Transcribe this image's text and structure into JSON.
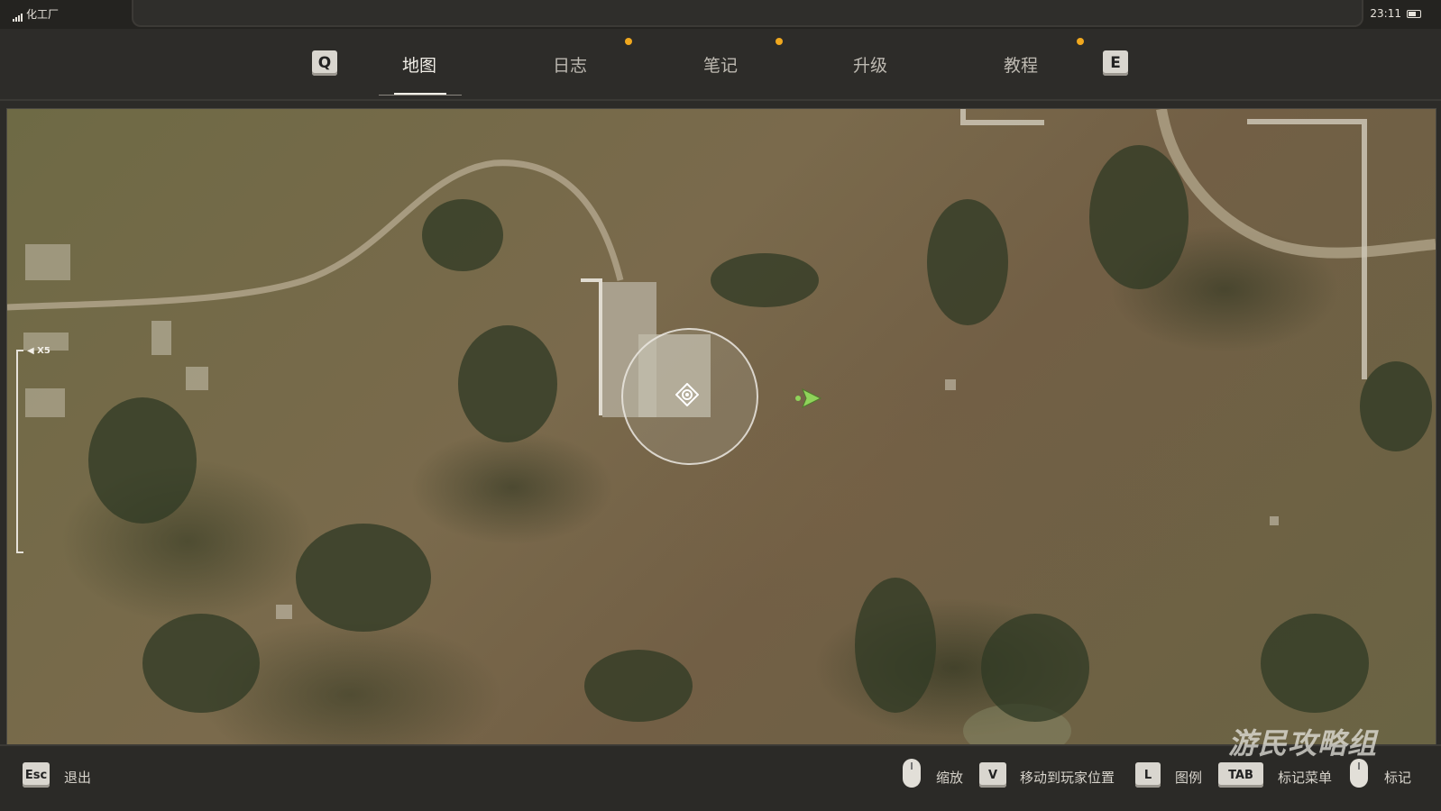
{
  "status": {
    "signal_label": "化工厂",
    "time": "23:11"
  },
  "tabs": {
    "left_key": "Q",
    "right_key": "E",
    "items": [
      {
        "label": "地图",
        "active": true,
        "notification": false
      },
      {
        "label": "日志",
        "active": false,
        "notification": true
      },
      {
        "label": "笔记",
        "active": false,
        "notification": true
      },
      {
        "label": "升级",
        "active": false,
        "notification": false
      },
      {
        "label": "教程",
        "active": false,
        "notification": true
      }
    ]
  },
  "map": {
    "zoom_label": "◀ X5",
    "player_icon": "player-location-icon",
    "objective_icon": "direction-arrow-icon",
    "marker_color": "#8fd35a"
  },
  "controls": {
    "exit_key": "Esc",
    "exit_label": "退出",
    "zoom_label": "缩放",
    "move_key": "V",
    "move_label": "移动到玩家位置",
    "legend_key": "L",
    "legend_label": "图例",
    "marker_menu_key": "TAB",
    "marker_menu_label": "标记菜单",
    "mark_label": "标记"
  },
  "watermark": "游民攻略组"
}
